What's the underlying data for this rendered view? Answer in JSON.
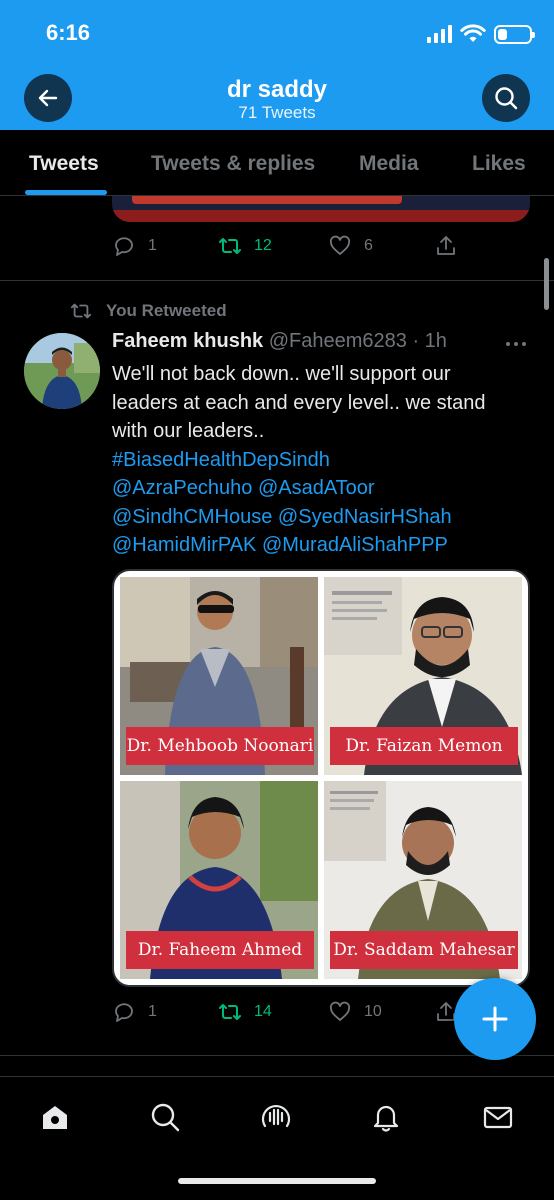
{
  "status_bar": {
    "time": "6:16",
    "battery_level": 0.3
  },
  "header": {
    "name": "dr saddy",
    "tweet_count": "71 Tweets",
    "back_icon": "arrow-left-icon",
    "search_icon": "search-icon"
  },
  "tabs": [
    {
      "label": "Tweets",
      "active": true
    },
    {
      "label": "Tweets & replies",
      "active": false
    },
    {
      "label": "Media",
      "active": false
    },
    {
      "label": "Likes",
      "active": false
    }
  ],
  "previous_tweet": {
    "replies": "1",
    "retweets": "12",
    "likes": "6"
  },
  "retweet_label": "You Retweeted",
  "tweet": {
    "author_name": "Faheem khushk",
    "author_handle": "@Faheem6283 · 1h",
    "text_lines": [
      "We'll not back down.. we'll support our",
      "leaders at each and every level.. we stand",
      "with our leaders.."
    ],
    "link_lines": [
      "#BiasedHealthDepSindh",
      "@AzraPechuho @AsadAToor",
      "@SindhCMHouse @SyedNasirHShah",
      "@HamidMirPAK @MuradAliShahPPP"
    ],
    "media_captions": [
      "Dr. Mehboob Noonari",
      "Dr. Faizan Memon",
      "Dr. Faheem Ahmed",
      "Dr. Saddam Mahesar"
    ],
    "replies": "1",
    "retweets": "14",
    "likes": "10"
  },
  "bottom_nav": [
    "home-icon",
    "search-icon",
    "spaces-icon",
    "notifications-icon",
    "messages-icon"
  ],
  "colors": {
    "accent": "#1d9bf0",
    "retweet": "#00ba7c",
    "caption_bg": "#d0303d",
    "background": "#000000"
  }
}
